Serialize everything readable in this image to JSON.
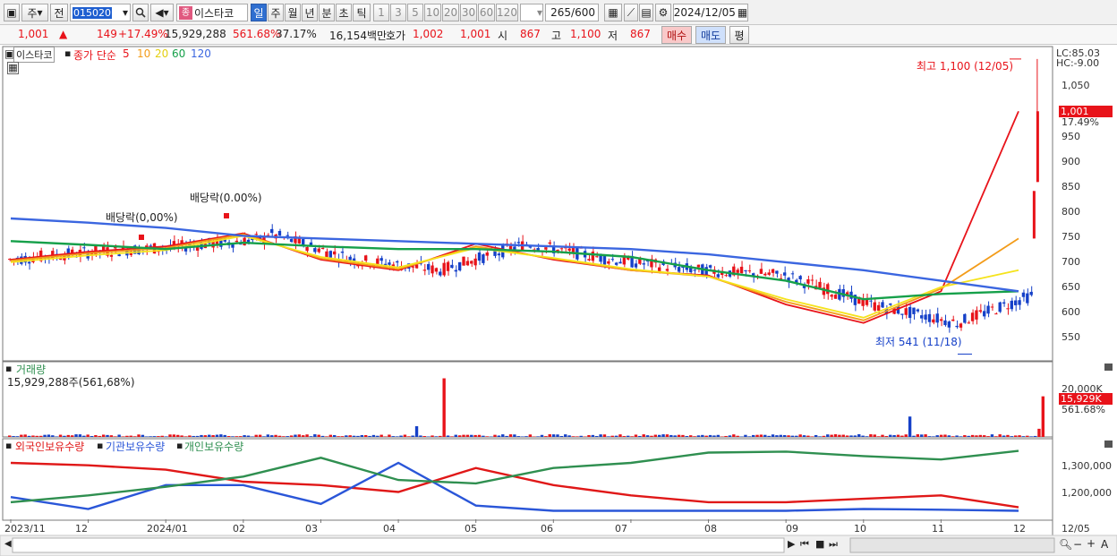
{
  "toolbar": {
    "period_kind": "주",
    "prev_label": "전",
    "stock_code": "015020",
    "stock_name": "이스타코",
    "name_prefix": "종",
    "interval_buttons": [
      "일",
      "주",
      "월",
      "년",
      "분",
      "초",
      "틱"
    ],
    "active_interval": "일",
    "minute_buttons": [
      "1",
      "3",
      "5",
      "10",
      "20",
      "30",
      "60",
      "120"
    ],
    "count": "265",
    "count_total": "/600",
    "date": "2024/12/05"
  },
  "quote": {
    "price": "1,001",
    "change_arrow": "▲",
    "change": "149",
    "change_pct": "+17.49%",
    "volume": "15,929,288",
    "volume_ratio": "561.68%",
    "turnover": "37.17%",
    "amount": "16,154백만",
    "bid_label": "호가",
    "ask": "1,002",
    "bid": "1,001",
    "open_label": "시",
    "open": "867",
    "high_label": "고",
    "high": "1,100",
    "low_label": "저",
    "low": "867",
    "buy_label": "매수",
    "sell_label": "매도",
    "flat_label": "평"
  },
  "legend": {
    "name": "이스타코",
    "ma_label": "종가 단순",
    "periods": [
      "5",
      "10",
      "20",
      "60",
      "120"
    ]
  },
  "price_axis": {
    "lc": "LC:85.03",
    "hc": "HC:-9.00",
    "ticks": [
      "1,050",
      "1,000",
      "950",
      "900",
      "850",
      "800",
      "750",
      "700",
      "650",
      "600",
      "550"
    ],
    "current": "1,001",
    "current_pct": "17.49%"
  },
  "annotations": {
    "high": "최고 1,100 (12/05)",
    "low": "최저 541 (11/18)",
    "dividend1": "배당락(0.00%)",
    "dividend2": "배당락(0,00%)"
  },
  "volume_panel": {
    "title": "거래량",
    "value": "15,929,288주(561,68%)",
    "axis_tick": "20,000K",
    "current": "15,929K",
    "current_pct": "561.68%"
  },
  "holdings_panel": {
    "series": [
      "외국인보유수량",
      "기관보유수량",
      "개인보유수량"
    ],
    "ticks": [
      "1,300,000",
      "1,200,000"
    ]
  },
  "date_axis": {
    "labels": [
      "2023/11",
      "12",
      "2024/01",
      "02",
      "03",
      "04",
      "05",
      "06",
      "07",
      "08",
      "09",
      "10",
      "11",
      "12"
    ],
    "end_label": "12/05"
  },
  "colors": {
    "up": "#e8131a",
    "down": "#1540c8",
    "ma5": "#e8131a",
    "ma10": "#f39c1a",
    "ma20": "#f5e31c",
    "ma60": "#16a04a",
    "ma120": "#3b66e0",
    "foreign": "#e01818",
    "institution": "#2a56d8",
    "individual": "#2f8f50"
  },
  "chart_data": {
    "type": "line",
    "x": [
      "2023/11",
      "12",
      "2024/01",
      "02",
      "03",
      "04",
      "05",
      "06",
      "07",
      "08",
      "09",
      "10",
      "11",
      "12/05"
    ],
    "series": [
      {
        "name": "5",
        "values": [
          720,
          735,
          745,
          770,
          720,
          700,
          750,
          720,
          700,
          690,
          635,
          600,
          660,
          1001
        ]
      },
      {
        "name": "10",
        "values": [
          718,
          732,
          742,
          768,
          722,
          702,
          745,
          722,
          700,
          688,
          640,
          605,
          665,
          760
        ]
      },
      {
        "name": "20",
        "values": [
          715,
          728,
          738,
          765,
          725,
          705,
          742,
          723,
          702,
          688,
          645,
          610,
          668,
          700
        ]
      },
      {
        "name": "60",
        "values": [
          755,
          748,
          740,
          752,
          745,
          740,
          740,
          735,
          725,
          700,
          680,
          645,
          655,
          660
        ]
      },
      {
        "name": "120",
        "values": [
          798,
          790,
          780,
          765,
          760,
          755,
          750,
          745,
          740,
          730,
          715,
          700,
          680,
          660
        ]
      }
    ],
    "high": {
      "value": 1100,
      "date": "12/05"
    },
    "low": {
      "value": 541,
      "date": "11/18"
    },
    "ylim": [
      530,
      1110
    ],
    "volume": {
      "current": 15929288,
      "ratio": "561.68%"
    },
    "holdings": [
      {
        "name": "외국인보유수량",
        "values": [
          1305000,
          1298000,
          1285000,
          1250000,
          1240000,
          1220000,
          1290000,
          1240000,
          1210000,
          1190000,
          1190000,
          1200000,
          1210000,
          1175000
        ]
      },
      {
        "name": "기관보유수량",
        "values": [
          1205000,
          1170000,
          1240000,
          1240000,
          1185000,
          1305000,
          1180000,
          1165000,
          1165000,
          1165000,
          1165000,
          1170000,
          1168000,
          1165000
        ]
      },
      {
        "name": "개인보유수량",
        "values": [
          1190000,
          1210000,
          1235000,
          1265000,
          1320000,
          1255000,
          1245000,
          1290000,
          1305000,
          1335000,
          1338000,
          1325000,
          1315000,
          1340000
        ]
      }
    ]
  }
}
